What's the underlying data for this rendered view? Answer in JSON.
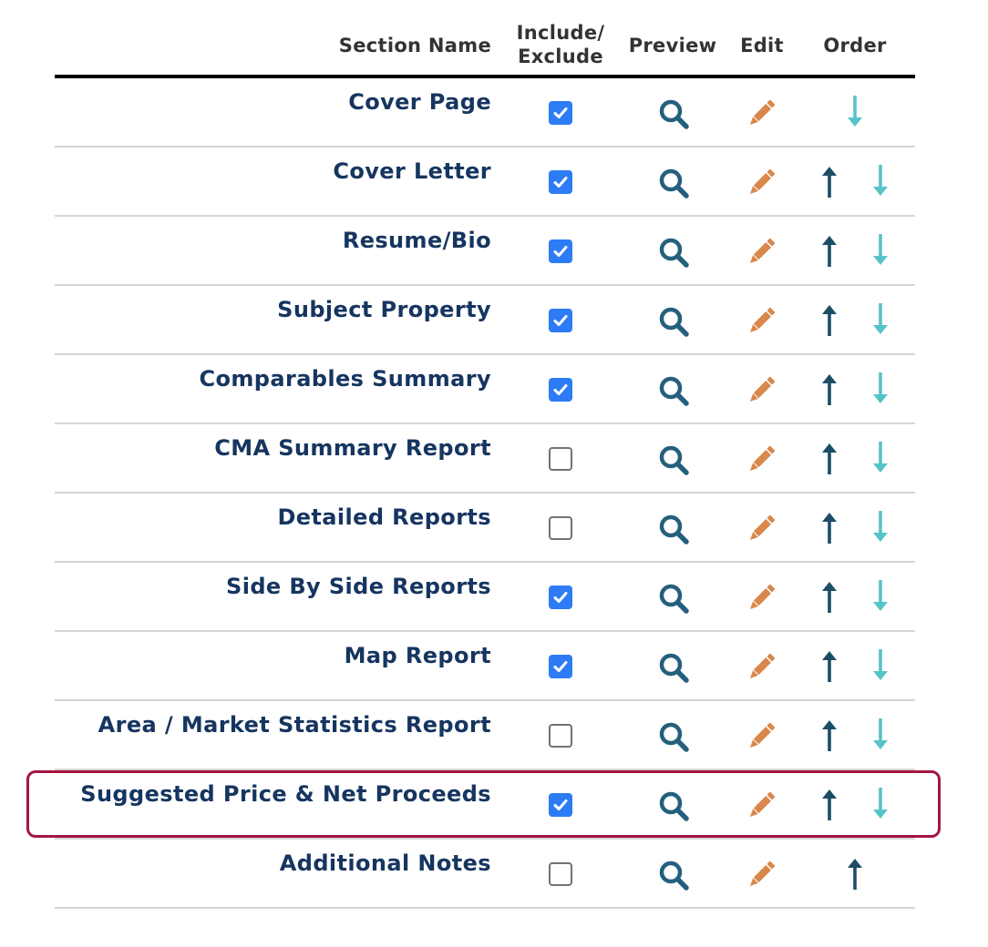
{
  "header": {
    "section_name": "Section Name",
    "include_exclude_line1": "Include/",
    "include_exclude_line2": "Exclude",
    "preview": "Preview",
    "edit": "Edit",
    "order": "Order"
  },
  "rows": [
    {
      "name": "Cover Page",
      "included": true,
      "up": false,
      "down": true
    },
    {
      "name": "Cover Letter",
      "included": true,
      "up": true,
      "down": true
    },
    {
      "name": "Resume/Bio",
      "included": true,
      "up": true,
      "down": true
    },
    {
      "name": "Subject Property",
      "included": true,
      "up": true,
      "down": true
    },
    {
      "name": "Comparables Summary",
      "included": true,
      "up": true,
      "down": true
    },
    {
      "name": "CMA Summary Report",
      "included": false,
      "up": true,
      "down": true
    },
    {
      "name": "Detailed Reports",
      "included": false,
      "up": true,
      "down": true
    },
    {
      "name": "Side By Side Reports",
      "included": true,
      "up": true,
      "down": true
    },
    {
      "name": "Map Report",
      "included": true,
      "up": true,
      "down": true
    },
    {
      "name": "Area / Market Statistics Report",
      "included": false,
      "up": true,
      "down": true
    },
    {
      "name": "Suggested Price & Net Proceeds",
      "included": true,
      "up": true,
      "down": true,
      "highlighted": true
    },
    {
      "name": "Additional Notes",
      "included": false,
      "up": true,
      "down": false
    }
  ],
  "icons": {
    "preview": "magnifier-icon",
    "edit": "pencil-icon",
    "up": "arrow-up-icon",
    "down": "arrow-down-icon"
  },
  "colors": {
    "section_text": "#163560",
    "header_text": "#333333",
    "checkbox_checked": "#2d7cf6",
    "preview_icon": "#255f7e",
    "edit_icon": "#d9874b",
    "up_arrow": "#1c4d66",
    "down_arrow": "#56c4c7",
    "highlight_border": "#a51540"
  }
}
